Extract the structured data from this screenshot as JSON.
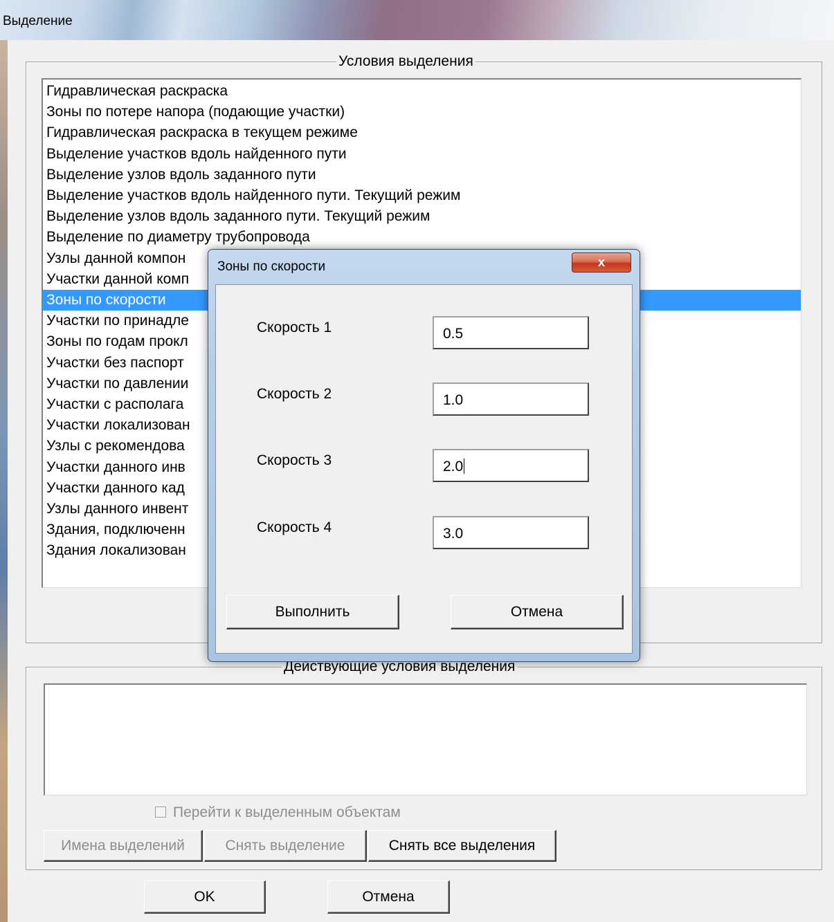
{
  "window": {
    "title": "Выделение"
  },
  "conditions_group": {
    "title": "Условия  выделения",
    "items": [
      "Гидравлическая раскраска",
      "Зоны по потере напора (подающие участки)",
      "Гидравлическая раскраска в текущем режиме",
      "Выделение участков вдоль найденного пути",
      "Выделение узлов вдоль заданного пути",
      "Выделение участков вдоль найденного пути. Текущий режим",
      "Выделение узлов вдоль заданного пути. Текущий режим",
      "Выделение по диаметру трубопровода",
      "Узлы данной компон",
      "Участки данной комп",
      "Зоны по скорости",
      "Участки по принадле",
      "Зоны по годам прокл",
      "Участки без паспорт",
      "Участки по давлении",
      "Участки с располага",
      "Участки локализован",
      "Узлы с рекомендова",
      "Участки данного инв",
      "Участки данного кад",
      "Узлы данного инвент",
      "Здания, подключенн",
      "Здания локализован"
    ],
    "selected_index": 10
  },
  "active_group": {
    "title": "Действующие  условия выделения",
    "checkbox_label": "Перейти к выделенным объектам",
    "checkbox_checked": false,
    "buttons": {
      "names": "Имена выделений",
      "clear": "Снять  выделение",
      "clear_all": "Снять все выделения"
    }
  },
  "footer": {
    "ok": "OK",
    "cancel": "Отмена"
  },
  "modal": {
    "title": "Зоны по скорости",
    "close_glyph": "x",
    "fields": [
      {
        "label": "Скорость 1",
        "value": "0.5"
      },
      {
        "label": "Скорость 2",
        "value": "1.0"
      },
      {
        "label": "Скорость 3",
        "value": "2.0"
      },
      {
        "label": "Скорость 4",
        "value": "3.0"
      }
    ],
    "focused_field_index": 2,
    "run_label": "Выполнить",
    "cancel_label": "Отмена"
  }
}
